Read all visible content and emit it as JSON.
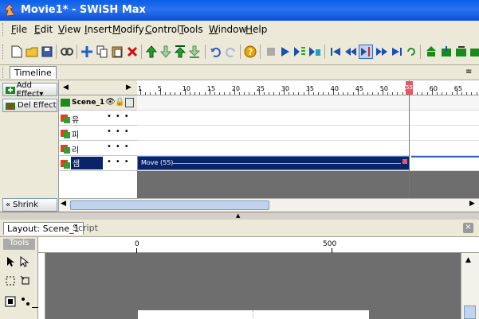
{
  "window": {
    "title": "Movie1* - SWiSH Max"
  },
  "menu": [
    "File",
    "Edit",
    "View",
    "Insert",
    "Modify",
    "Control",
    "Tools",
    "Window",
    "Help"
  ],
  "toolbar": {
    "icons": [
      "new-icon",
      "open-icon",
      "save-icon",
      "link-icon",
      "move-icon",
      "copy-icon",
      "paste-icon",
      "delete-icon",
      "up-icon",
      "down-icon",
      "top-icon",
      "bottom-icon",
      "undo-icon",
      "redo-icon",
      "help-icon",
      "stop-icon",
      "play-icon",
      "play-frame-icon",
      "play-scene-icon",
      "rewind-icon",
      "prev-icon",
      "frame-marker-icon",
      "next-icon",
      "end-icon",
      "loop-icon",
      "tree-icon",
      "export-icon",
      "publish-icon",
      "test-icon"
    ]
  },
  "timeline": {
    "tab_label": "Timeline",
    "add_effect_label": "Add Effect▾",
    "del_effect_label": "Del Effect",
    "shrink_label": "Shrink",
    "scene_label": "Scene_1",
    "layers": [
      {
        "name": "유",
        "selected": false
      },
      {
        "name": "피",
        "selected": false
      },
      {
        "name": "리",
        "selected": false
      },
      {
        "name": "샘",
        "selected": true
      }
    ],
    "ruler_labels": [
      "1",
      "5",
      "10",
      "15",
      "20",
      "25",
      "30",
      "35",
      "40",
      "45",
      "50",
      "55",
      "60",
      "65"
    ],
    "current_frame": "55",
    "effect_label": "Move (55)"
  },
  "layout": {
    "tab_label": "Layout: Scene_1",
    "script_label": "Script",
    "tools_label": "Tools",
    "ruler_labels": [
      "0",
      "500"
    ]
  },
  "colors": {
    "titlebar": "#0a5ee8",
    "selection": "#0a246a",
    "playhead": "#e05a6a"
  }
}
